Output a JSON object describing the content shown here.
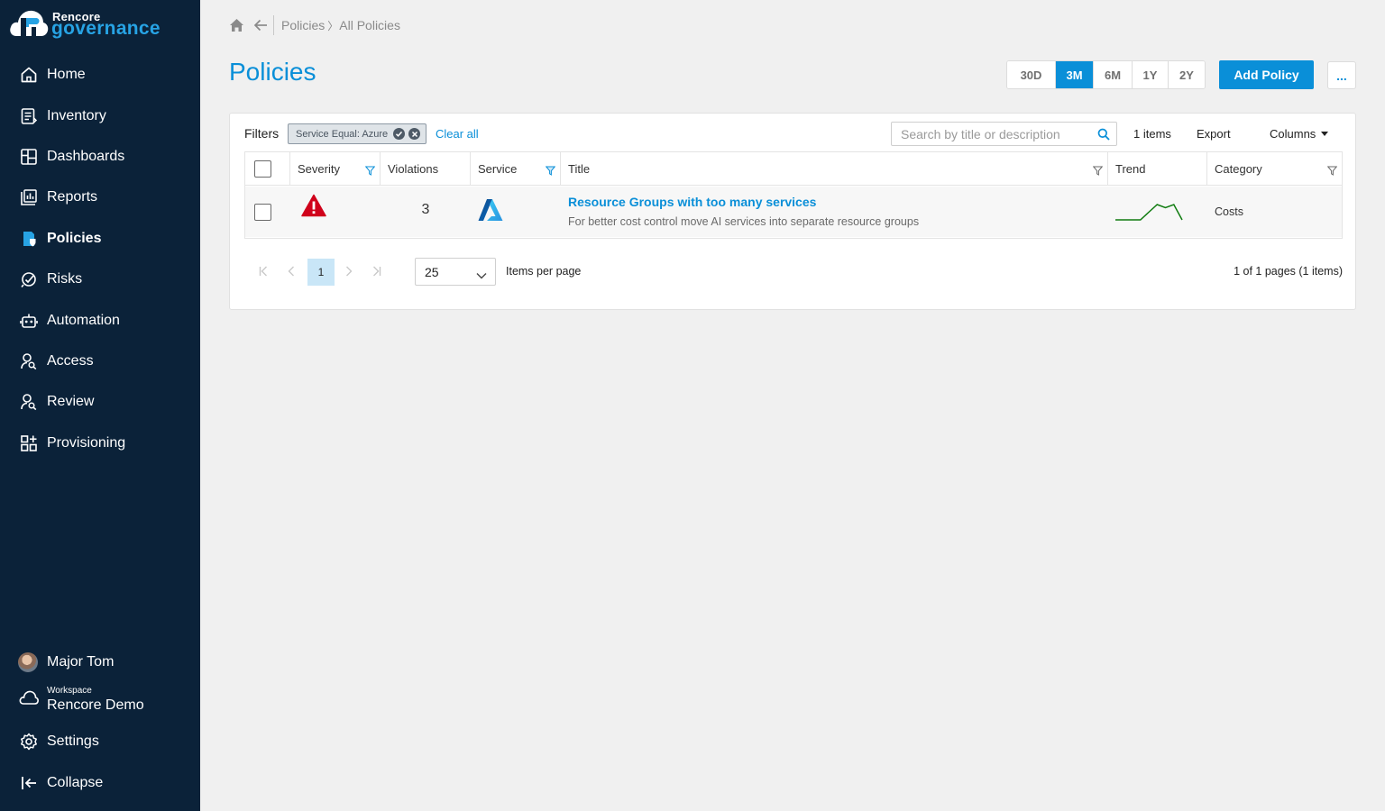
{
  "brand": {
    "top": "Rencore",
    "bottom": "governance"
  },
  "sidebar": {
    "items": [
      {
        "label": "Home",
        "icon": "home-icon"
      },
      {
        "label": "Inventory",
        "icon": "inventory-icon"
      },
      {
        "label": "Dashboards",
        "icon": "dashboards-icon"
      },
      {
        "label": "Reports",
        "icon": "reports-icon"
      },
      {
        "label": "Policies",
        "icon": "policies-icon",
        "active": true
      },
      {
        "label": "Risks",
        "icon": "risks-icon"
      },
      {
        "label": "Automation",
        "icon": "robot-icon"
      },
      {
        "label": "Access",
        "icon": "user-search-icon"
      },
      {
        "label": "Review",
        "icon": "user-search-icon"
      },
      {
        "label": "Provisioning",
        "icon": "apps-add-icon"
      }
    ],
    "user": {
      "name": "Major Tom"
    },
    "workspace": {
      "label": "Workspace",
      "name": "Rencore Demo"
    },
    "settings": "Settings",
    "collapse": "Collapse"
  },
  "breadcrumb": {
    "first": "Policies",
    "separator": "〉",
    "second": "All Policies"
  },
  "page": {
    "title": "Policies"
  },
  "ranges": [
    "30D",
    "3M",
    "6M",
    "1Y",
    "2Y"
  ],
  "active_range": "3M",
  "toolbar": {
    "add_label": "Add Policy",
    "more_label": "..."
  },
  "filters": {
    "label": "Filters",
    "chip": "Service Equal: Azure",
    "clear": "Clear all",
    "search_placeholder": "Search by title or description",
    "count": "1 items",
    "export": "Export",
    "columns": "Columns"
  },
  "table": {
    "headers": {
      "severity": "Severity",
      "violations": "Violations",
      "service": "Service",
      "title": "Title",
      "trend": "Trend",
      "category": "Category"
    },
    "rows": [
      {
        "violations": "3",
        "title": "Resource Groups with too many services",
        "description": "For better cost control move AI services into separate resource groups",
        "category": "Costs",
        "trend": [
          0,
          0,
          0,
          0,
          0.5,
          1,
          0.8,
          1,
          0
        ]
      }
    ]
  },
  "pagination": {
    "page": "1",
    "per_page": "25",
    "per_page_label": "Items per page",
    "info": "1 of 1 pages (1 items)"
  },
  "colors": {
    "sidebar": "#0b2239",
    "accent": "#0a8fd8",
    "severity_high": "#d0021b",
    "trend_line": "#107c10"
  }
}
